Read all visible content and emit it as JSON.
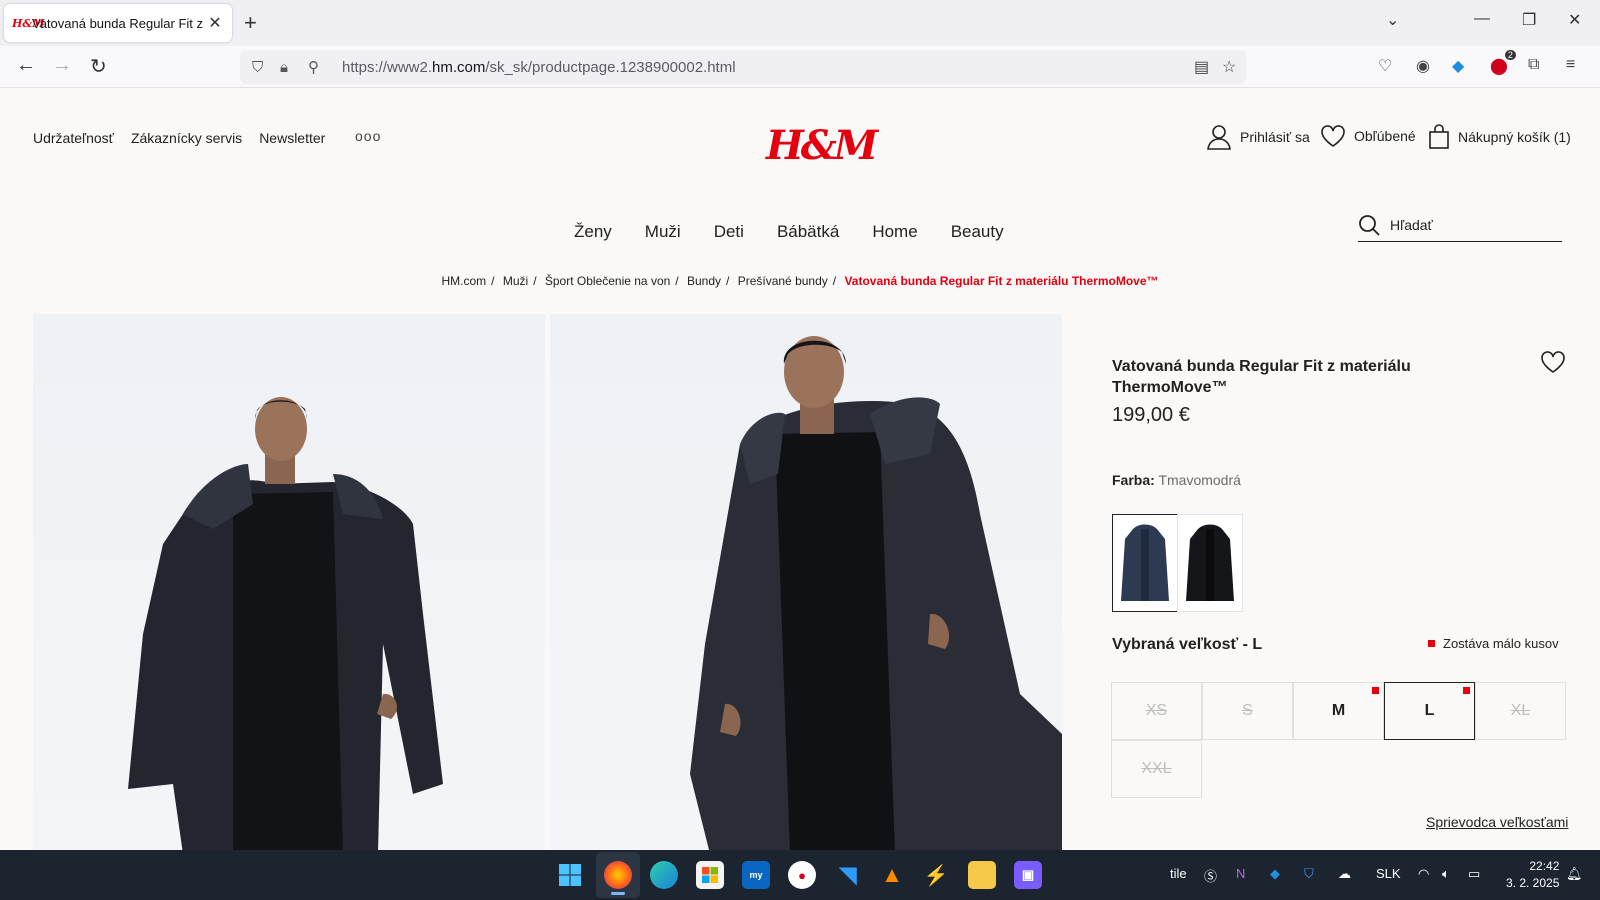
{
  "browser": {
    "tab_title": "Vatovaná bunda Regular Fit z m",
    "tab_favicon": "H&M",
    "url_prefix": "https://www2.",
    "url_domain": "hm.com",
    "url_path": "/sk_sk/productpage.1238900002.html",
    "addon_badge": "2"
  },
  "header": {
    "top_links": [
      "Udržateľnosť",
      "Zákaznícky servis",
      "Newsletter"
    ],
    "more": "ooo",
    "logo": "H&M",
    "login": "Prihlásiť sa",
    "favorites": "Obľúbené",
    "cart": "Nákupný košík (1)"
  },
  "nav": {
    "items": [
      "Ženy",
      "Muži",
      "Deti",
      "Bábätká",
      "Home",
      "Beauty"
    ],
    "search_placeholder": "Hľadať"
  },
  "breadcrumb": {
    "items": [
      "HM.com",
      "Muži",
      "Šport Oblečenie na von",
      "Bundy",
      "Prešívané bundy"
    ],
    "current": "Vatovaná bunda Regular Fit z materiálu ThermoMove™"
  },
  "product": {
    "title": "Vatovaná bunda Regular Fit z materiálu ThermoMove™",
    "price": "199,00 €",
    "color_label": "Farba:",
    "color_value": "Tmavomodrá",
    "swatches": [
      "navy",
      "black"
    ],
    "size_label": "Vybraná veľkosť - L",
    "low_stock": "Zostáva málo kusov",
    "sizes": [
      "XS",
      "S",
      "M",
      "L",
      "XL",
      "XXL"
    ],
    "size_available": [
      false,
      false,
      true,
      true,
      false,
      false
    ],
    "size_low_stock": [
      false,
      false,
      true,
      true,
      false,
      false
    ],
    "selected_size": "L",
    "size_guide": "Sprievodca veľkosťami"
  },
  "taskbar": {
    "tray_text": "tile",
    "language": "SLK",
    "time": "22:42",
    "date": "3. 2. 2025"
  },
  "colors": {
    "brand": "#e50010",
    "taskbar": "#1c2430"
  }
}
